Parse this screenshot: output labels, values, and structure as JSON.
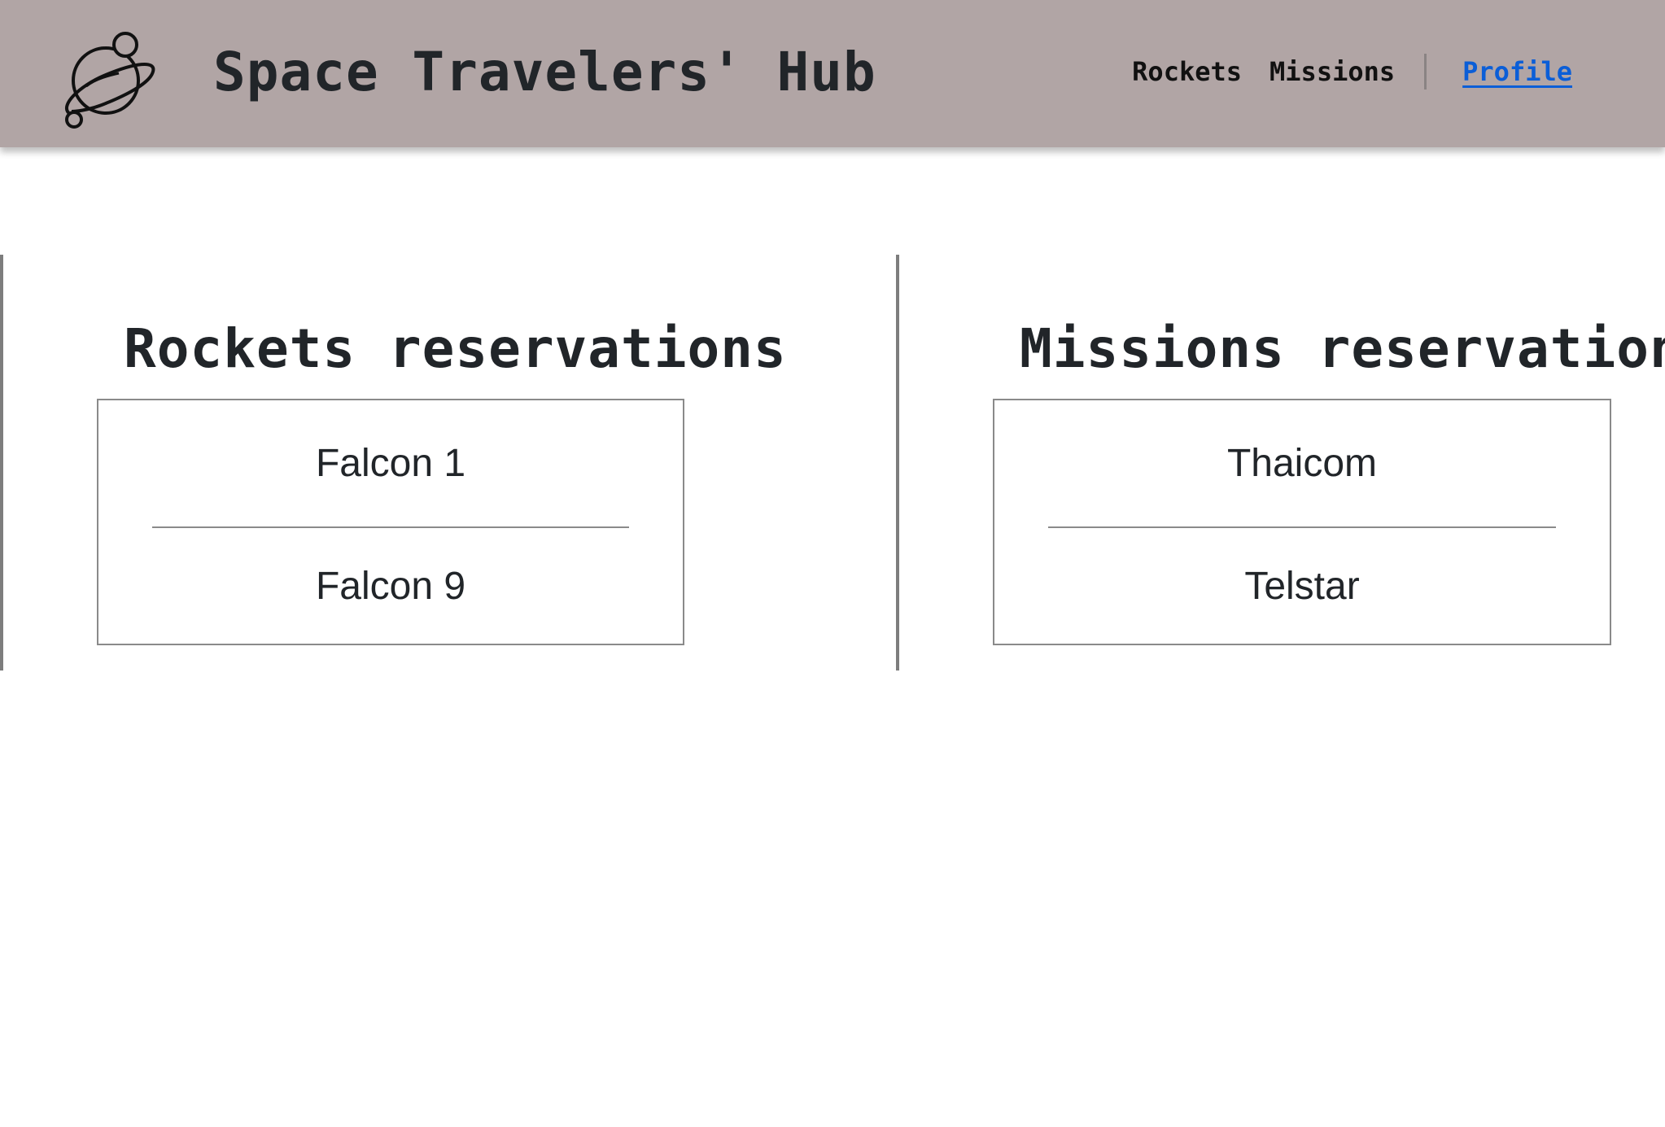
{
  "header": {
    "brand": "Space Travelers' Hub",
    "logo_icon": "planet-icon",
    "nav": [
      {
        "label": "Rockets",
        "active": false
      },
      {
        "label": "Missions",
        "active": false
      },
      {
        "label": "Profile",
        "active": true
      }
    ],
    "background_color": "#b1a5a5",
    "active_link_color": "#0b5ed7"
  },
  "main": {
    "rockets": {
      "title": "Rockets reservations",
      "items": [
        "Falcon 1",
        "Falcon 9"
      ]
    },
    "missions": {
      "title": "Missions reservations",
      "items": [
        "Thaicom",
        "Telstar"
      ]
    }
  }
}
